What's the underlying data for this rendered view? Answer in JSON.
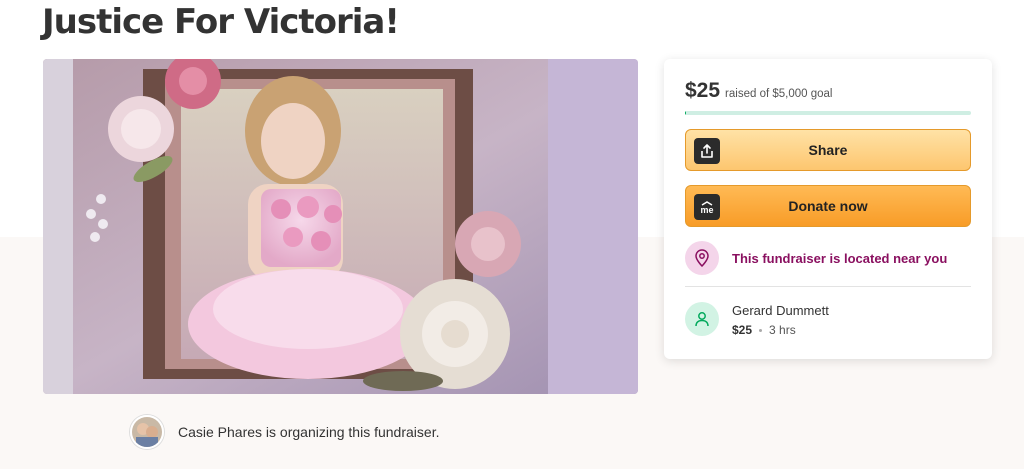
{
  "page": {
    "title": "Justice For Victoria!"
  },
  "organizer": {
    "text": "Casie Phares is organizing this fundraiser."
  },
  "donation_card": {
    "amount_raised": "$25",
    "goal_text": "raised of $5,000 goal",
    "progress_fraction": 0.005,
    "share_label": "Share",
    "donate_label": "Donate now",
    "donate_icon_text": "me",
    "location_text": "This fundraiser is located near you",
    "recent_donation": {
      "name": "Gerard Dummett",
      "amount": "$25",
      "time": "3 hrs"
    }
  },
  "icons": {
    "share": "share-icon",
    "donate": "gofundme-icon",
    "location": "map-pin-icon",
    "donor": "donor-heart-icon"
  },
  "colors": {
    "progress": "#02a95c",
    "share_button": "#fdc66f",
    "donate_button": "#f89c27",
    "location_text": "#8a1060"
  }
}
